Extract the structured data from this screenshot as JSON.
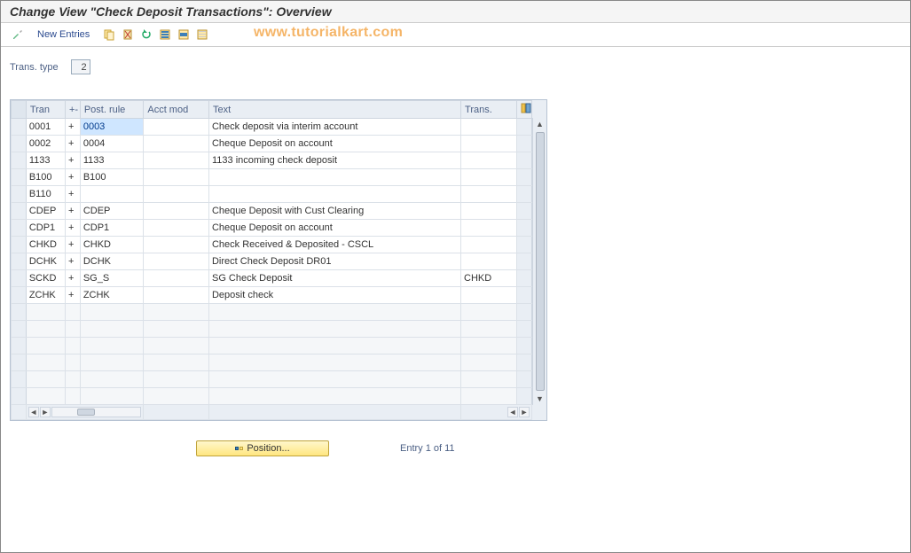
{
  "title": "Change View \"Check Deposit Transactions\": Overview",
  "toolbar": {
    "new_entries": "New Entries"
  },
  "watermark": "www.tutorialkart.com",
  "field": {
    "label": "Trans. type",
    "value": "2"
  },
  "columns": {
    "tran": "Tran",
    "pm": "+-",
    "post_rule": "Post. rule",
    "acct_mod": "Acct mod",
    "text": "Text",
    "trans": "Trans."
  },
  "rows": [
    {
      "tran": "0001",
      "pm": "+",
      "post": "0003",
      "acct": "",
      "text": "Check deposit via interim account",
      "trans": "",
      "sel": true
    },
    {
      "tran": "0002",
      "pm": "+",
      "post": "0004",
      "acct": "",
      "text": "Cheque Deposit on account",
      "trans": ""
    },
    {
      "tran": "1133",
      "pm": "+",
      "post": "1133",
      "acct": "",
      "text": "1133 incoming check deposit",
      "trans": ""
    },
    {
      "tran": "B100",
      "pm": "+",
      "post": "B100",
      "acct": "",
      "text": "",
      "trans": ""
    },
    {
      "tran": "B110",
      "pm": "+",
      "post": "",
      "acct": "",
      "text": "",
      "trans": ""
    },
    {
      "tran": "CDEP",
      "pm": "+",
      "post": "CDEP",
      "acct": "",
      "text": "Cheque Deposit with Cust Clearing",
      "trans": ""
    },
    {
      "tran": "CDP1",
      "pm": "+",
      "post": "CDP1",
      "acct": "",
      "text": "Cheque Deposit on account",
      "trans": ""
    },
    {
      "tran": "CHKD",
      "pm": "+",
      "post": "CHKD",
      "acct": "",
      "text": "Check Received & Deposited - CSCL",
      "trans": ""
    },
    {
      "tran": "DCHK",
      "pm": "+",
      "post": "DCHK",
      "acct": "",
      "text": "Direct Check Deposit DR01",
      "trans": ""
    },
    {
      "tran": "SCKD",
      "pm": "+",
      "post": "SG_S",
      "acct": "",
      "text": "SG Check Deposit",
      "trans": "CHKD"
    },
    {
      "tran": "ZCHK",
      "pm": "+",
      "post": "ZCHK",
      "acct": "",
      "text": "Deposit check",
      "trans": ""
    }
  ],
  "empty_rows": 6,
  "footer": {
    "position_label": "Position...",
    "entry_info": "Entry 1 of 11"
  },
  "icons": {
    "toggle": "toggle-display-change",
    "copy": "copy-icon",
    "save": "save-icon",
    "undo": "undo-icon",
    "select_all": "select-all-icon",
    "select_block": "select-block-icon",
    "deselect": "deselect-all-icon"
  }
}
